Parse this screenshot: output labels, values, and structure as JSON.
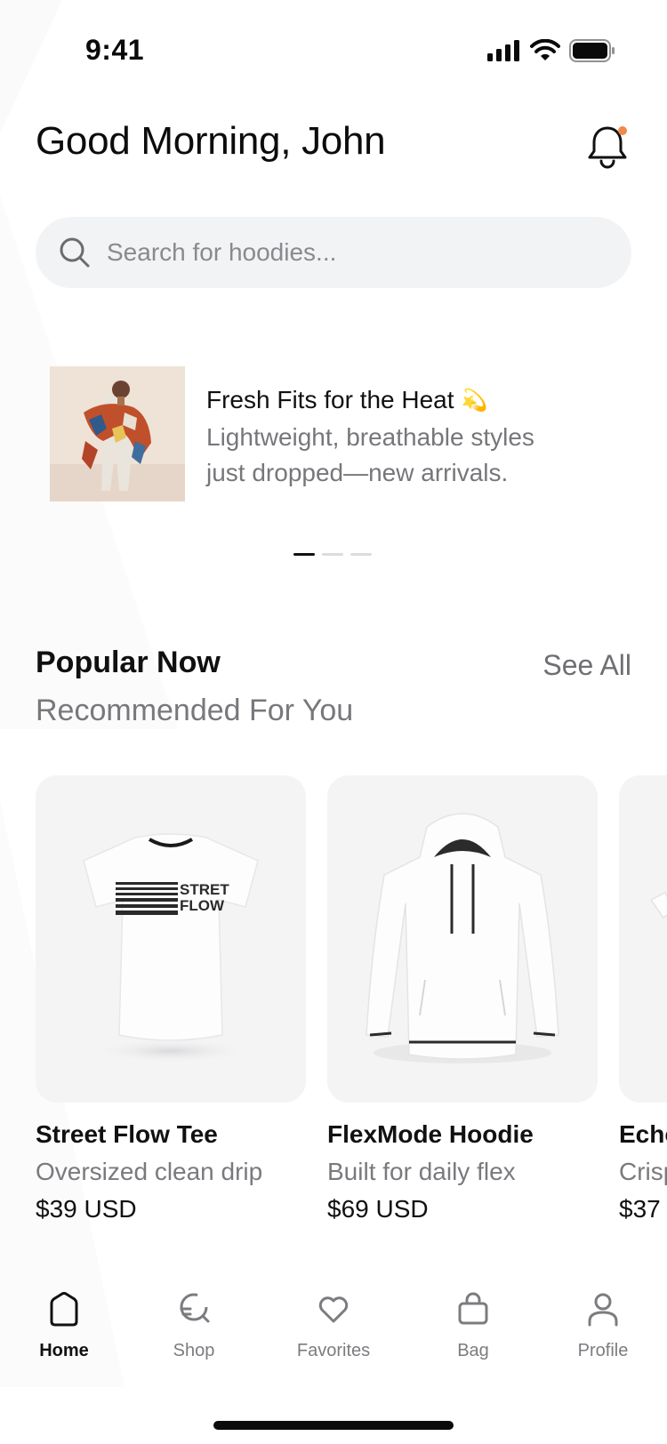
{
  "status_bar": {
    "time": "9:41"
  },
  "header": {
    "greeting": "Good Morning, John"
  },
  "search": {
    "placeholder": "Search for hoodies..."
  },
  "promo": {
    "title": "Fresh Fits for the Heat",
    "title_emoji": "💫",
    "description": "Lightweight, breathable styles just dropped—new arrivals.",
    "carousel_pages": 3,
    "carousel_active_index": 0
  },
  "section": {
    "title": "Popular Now",
    "see_all": "See All",
    "subtitle": "Recommended For You"
  },
  "products": [
    {
      "name": "Street Flow Tee",
      "description": "Oversized clean drip",
      "price": "$39 USD",
      "print_text_line1": "STRET",
      "print_text_line2": "FLOW"
    },
    {
      "name": "FlexMode Hoodie",
      "description": "Built for daily flex",
      "price": "$69 USD"
    },
    {
      "name": "Echo",
      "description": "Crisp",
      "price": "$37"
    }
  ],
  "tabs": [
    {
      "label": "Home",
      "icon": "home-icon",
      "active": true
    },
    {
      "label": "Shop",
      "icon": "shop-icon",
      "active": false
    },
    {
      "label": "Favorites",
      "icon": "heart-icon",
      "active": false
    },
    {
      "label": "Bag",
      "icon": "bag-icon",
      "active": false
    },
    {
      "label": "Profile",
      "icon": "profile-icon",
      "active": false
    }
  ],
  "colors": {
    "accent_dot": "#f08a4b",
    "search_bg": "#f2f3f5",
    "card_bg": "#f4f4f5",
    "text_primary": "#111111",
    "text_secondary": "#77777b"
  }
}
